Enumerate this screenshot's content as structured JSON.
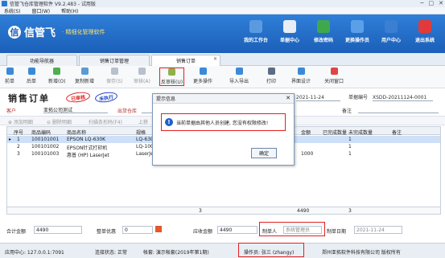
{
  "window": {
    "title": "信管飞仓库管理软件 V9.2.483 - 试用版",
    "controls": [
      "─",
      "□",
      "✕"
    ]
  },
  "menu": [
    {
      "label": "系统(S)"
    },
    {
      "label": "窗口(W)"
    },
    {
      "label": "帮助(H)"
    }
  ],
  "brand": {
    "name": "信管飞",
    "slogan": "· 精细化管理软件"
  },
  "topnav": [
    {
      "label": "我的工作台",
      "icon": "monitor-icon",
      "color": "#5a9be0"
    },
    {
      "label": "单据中心",
      "icon": "document-icon",
      "color": "#e8edf5"
    },
    {
      "label": "修改密码",
      "icon": "lock-icon",
      "color": "#3fa84d"
    },
    {
      "label": "更换操作员",
      "icon": "user-switch-icon",
      "color": "#5aa0e8"
    },
    {
      "label": "用户中心",
      "icon": "user-icon",
      "color": "#3a7fd1"
    },
    {
      "label": "退出系统",
      "icon": "power-icon",
      "color": "#e23a3a"
    }
  ],
  "tabs": [
    {
      "label": "功能导航器"
    },
    {
      "label": "销售订单管理"
    },
    {
      "label": "销售订单"
    }
  ],
  "toolbar": [
    {
      "label": "前单",
      "icon": "arrow-left-icon",
      "color": "#3a8ad8"
    },
    {
      "label": "后单",
      "icon": "arrow-right-icon",
      "color": "#3a8ad8"
    },
    {
      "label": "新增(O)",
      "icon": "plus-icon",
      "color": "#4caf50"
    },
    {
      "label": "复制新增",
      "icon": "copy-icon",
      "color": "#5b9bd5"
    },
    {
      "label": "保存(S)",
      "icon": "save-icon",
      "color": "#b8c0cc"
    },
    {
      "label": "审核(A)",
      "icon": "approve-icon",
      "color": "#b8c0cc"
    },
    {
      "label": "反审核(U)",
      "icon": "unapprove-icon",
      "color": "#8fb04a"
    },
    {
      "label": "更多操作",
      "icon": "more-icon",
      "color": "#3a8ad8"
    },
    {
      "label": "导入导出",
      "icon": "import-export-icon",
      "color": "#3a8ad8"
    },
    {
      "label": "打印",
      "icon": "print-icon",
      "color": "#5b6d85"
    },
    {
      "label": "界面设计",
      "icon": "layout-icon",
      "color": "#3a8ad8"
    },
    {
      "label": "关闭窗口",
      "icon": "close-window-icon",
      "color": "#e04545"
    }
  ],
  "order": {
    "title": "销售订单",
    "stamp_audited": "已审核",
    "stamp_pending": "未执行",
    "date_label": "日期",
    "date": "2021-11-24",
    "number_label": "单据编号",
    "number": "XSDD-20211124-0001",
    "customer_label": "客户",
    "customer": "亚拓公司测试",
    "warehouse_label": "出货仓库",
    "remark_label": "备注"
  },
  "subtoolbar": [
    "⊕ 添加明细",
    "⊖ 删除明细",
    "扫描条形码(F4)",
    "上移"
  ],
  "grid": {
    "columns": [
      "序号",
      "商品编码",
      "商品名称",
      "规格",
      "单价",
      "数量",
      "折扣",
      "金额",
      "已完成数量",
      "未完成数量",
      "备注"
    ],
    "rows": [
      {
        "no": "1",
        "code": "100101001",
        "name": "EPSON LQ-630K",
        "spec": "LQ-630K",
        "price": "",
        "qty": "",
        "disc": "",
        "amount": "",
        "done": "",
        "undone": "1"
      },
      {
        "no": "2",
        "code": "100101002",
        "name": "EPSON针式打印机",
        "spec": "LQ-1000K",
        "price": "",
        "qty": "",
        "disc": "",
        "amount": "",
        "done": "",
        "undone": "1"
      },
      {
        "no": "3",
        "code": "100101003",
        "name": "惠普 (HP) LaserJet",
        "spec": "LaserJet 100",
        "price": "1000",
        "qty": "1",
        "disc": "",
        "amount": "1000",
        "done": "",
        "undone": "1"
      }
    ],
    "total_qty": "3",
    "total_amount": "4490",
    "total_undone": "3"
  },
  "footer": {
    "total_label": "合计金额",
    "total": "4490",
    "discount_label": "整单优惠",
    "discount": "0",
    "receivable_label": "应收金额",
    "receivable": "4490",
    "maker_label": "制单人",
    "maker": "系统管理员",
    "make_date_label": "制单日期",
    "make_date": "2021-11-24"
  },
  "status": {
    "app_center": "应用中心: 127.0.0.1:7091",
    "connection": "连接状态: 正常",
    "account": "帐套: 演示帐套(2019年第1期)",
    "operator": "操作员: 张三 (zhangy)",
    "company": "郑州亚拓软件科技有限公司 版权所有"
  },
  "dialog": {
    "title": "提示信息",
    "message": "当前单据由其他人员创建, 您没有权限修改!",
    "ok": "确定",
    "close": "✕"
  }
}
